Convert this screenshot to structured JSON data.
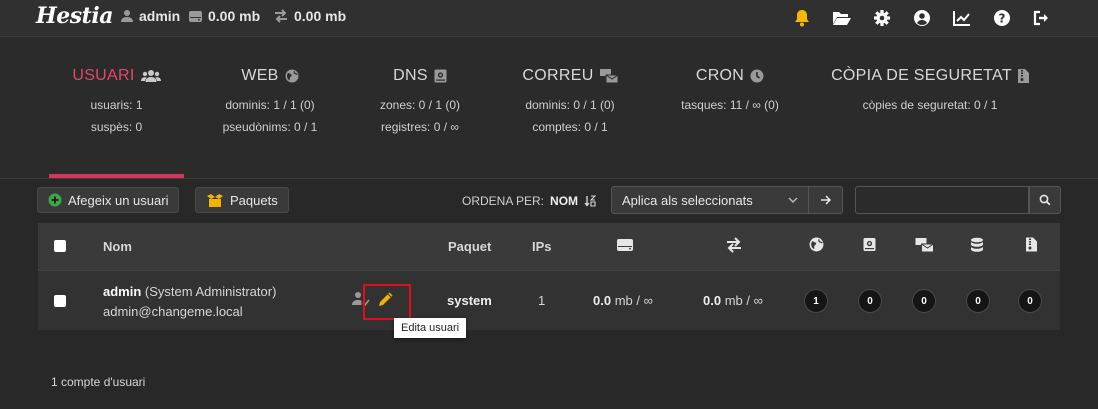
{
  "topbar": {
    "logo": "Hestia",
    "user": "admin",
    "disk": "0.00 mb",
    "bandwidth": "0.00 mb",
    "icons": [
      "bell-icon",
      "folder-open-icon",
      "gear-icon",
      "user-circle-icon",
      "chart-line-icon",
      "question-icon",
      "sign-out-icon"
    ]
  },
  "stats": [
    {
      "title": "USUARI",
      "icon": "users-icon",
      "lines": [
        "usuaris: 1",
        "suspès: 0"
      ],
      "active": true
    },
    {
      "title": "WEB",
      "icon": "globe-icon",
      "lines": [
        "dominis: 1 / 1 (0)",
        "pseudònims: 0 / 1"
      ]
    },
    {
      "title": "DNS",
      "icon": "book-icon",
      "lines": [
        "zones: 0 / 1 (0)",
        "registres: 0 / ∞"
      ]
    },
    {
      "title": "CORREU",
      "icon": "mail-bulk-icon",
      "lines": [
        "dominis: 0 / 1 (0)",
        "comptes: 0 / 1"
      ]
    },
    {
      "title": "CRON",
      "icon": "clock-icon",
      "lines": [
        "tasques: 11 / ∞ (0)"
      ]
    },
    {
      "title": "CÒPIA DE SEGURETAT",
      "icon": "file-archive-icon",
      "lines": [
        "còpies de seguretat: 0 / 1"
      ]
    }
  ],
  "toolbar": {
    "add_user": "Afegeix un usuari",
    "packages": "Paquets",
    "sort_label": "ORDENA PER:",
    "sort_value": "NOM",
    "bulk_select": "Aplica als seleccionats",
    "search_placeholder": ""
  },
  "table": {
    "headers": {
      "name": "Nom",
      "package": "Paquet",
      "ips": "IPs"
    },
    "header_icons": [
      "hdd-icon",
      "exchange-icon",
      "globe-icon",
      "book-icon",
      "mail-bulk-icon",
      "database-icon",
      "file-archive-icon"
    ],
    "rows": [
      {
        "user": "admin",
        "full_name": "(System Administrator)",
        "email": "admin@changeme.local",
        "package": "system",
        "ips": "1",
        "disk_value": "0.0",
        "disk_unit": "mb / ∞",
        "bw_value": "0.0",
        "bw_unit": "mb / ∞",
        "counts": [
          "1",
          "0",
          "0",
          "0",
          "0"
        ]
      }
    ]
  },
  "tooltip": "Edita usuari",
  "footer": "1 compte d'usuari",
  "colors": {
    "accent": "#d2365c",
    "edit_icon": "#f0b400",
    "bell": "#f5b800",
    "add_icon": "#3aa84a",
    "highlight_box": "#e0101a"
  }
}
